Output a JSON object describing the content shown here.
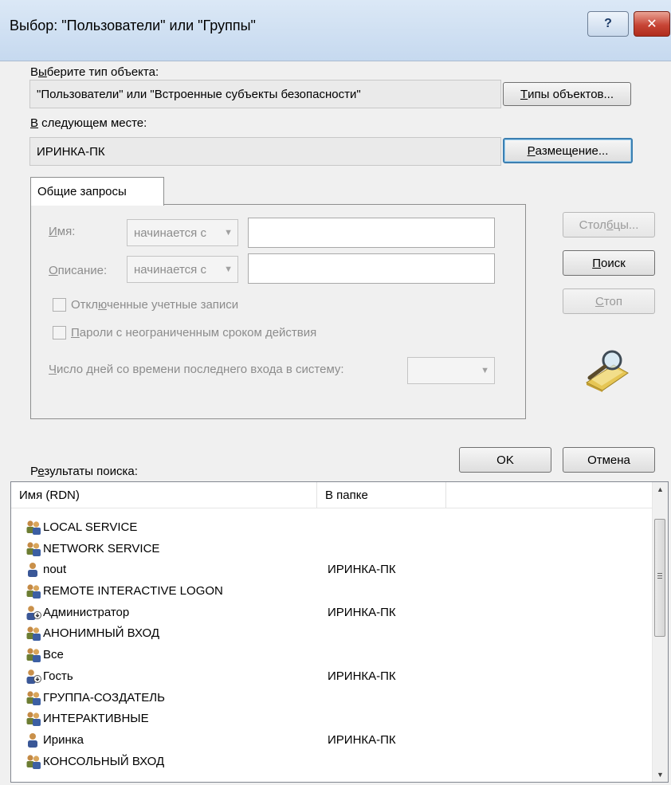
{
  "window": {
    "title": "Выбор: \"Пользователи\" или \"Группы\"",
    "help_label": "?",
    "close_label": "✕"
  },
  "object_type": {
    "label_pre": "В",
    "label_u": "ы",
    "label_post": "берите тип объекта:",
    "value": "\"Пользователи\" или \"Встроенные субъекты безопасности\"",
    "button_u": "Т",
    "button_rest": "ипы объектов..."
  },
  "location": {
    "label_u": "В",
    "label_post": " следующем месте:",
    "value": "ИРИНКА-ПК",
    "button_u": "Р",
    "button_rest": "азмещение..."
  },
  "tab": {
    "label": "Общие запросы"
  },
  "query": {
    "name_label_u": "И",
    "name_label_post": "мя:",
    "name_combo": "начинается с",
    "desc_label_u": "О",
    "desc_label_post": "писание:",
    "desc_combo": "начинается с",
    "disabled_accounts_pre": "Откл",
    "disabled_accounts_u": "ю",
    "disabled_accounts_post": "ченные учетные записи",
    "no_expire_u": "П",
    "no_expire_post": "ароли с неограниченным сроком действия",
    "days_u": "Ч",
    "days_post": "исло дней со времени последнего входа в систему:",
    "days_value": ""
  },
  "buttons": {
    "columns_pre": "Стол",
    "columns_u": "б",
    "columns_post": "цы...",
    "search_u": "П",
    "search_post": "оиск",
    "stop_u": "С",
    "stop_post": "топ",
    "ok": "OK",
    "cancel": "Отмена"
  },
  "results": {
    "label_pre": "Р",
    "label_u": "е",
    "label_post": "зультаты поиска:",
    "col_name": "Имя (RDN)",
    "col_folder": "В папке",
    "items": [
      {
        "name": "LOCAL SERVICE",
        "folder": "",
        "icon": "group-icon"
      },
      {
        "name": "NETWORK SERVICE",
        "folder": "",
        "icon": "group-icon"
      },
      {
        "name": "nout",
        "folder": "ИРИНКА-ПК",
        "icon": "user-icon"
      },
      {
        "name": "REMOTE INTERACTIVE LOGON",
        "folder": "",
        "icon": "group-icon"
      },
      {
        "name": "Администратор",
        "folder": "ИРИНКА-ПК",
        "icon": "disabled-user-icon"
      },
      {
        "name": "АНОНИМНЫЙ ВХОД",
        "folder": "",
        "icon": "group-icon"
      },
      {
        "name": "Все",
        "folder": "",
        "icon": "group-icon"
      },
      {
        "name": "Гость",
        "folder": "ИРИНКА-ПК",
        "icon": "disabled-user-icon"
      },
      {
        "name": "ГРУППА-СОЗДАТЕЛЬ",
        "folder": "",
        "icon": "group-icon"
      },
      {
        "name": "ИНТЕРАКТИВНЫЕ",
        "folder": "",
        "icon": "group-icon"
      },
      {
        "name": "Иринка",
        "folder": "ИРИНКА-ПК",
        "icon": "user-icon"
      },
      {
        "name": "КОНСОЛЬНЫЙ ВХОД",
        "folder": "",
        "icon": "group-icon"
      }
    ]
  }
}
